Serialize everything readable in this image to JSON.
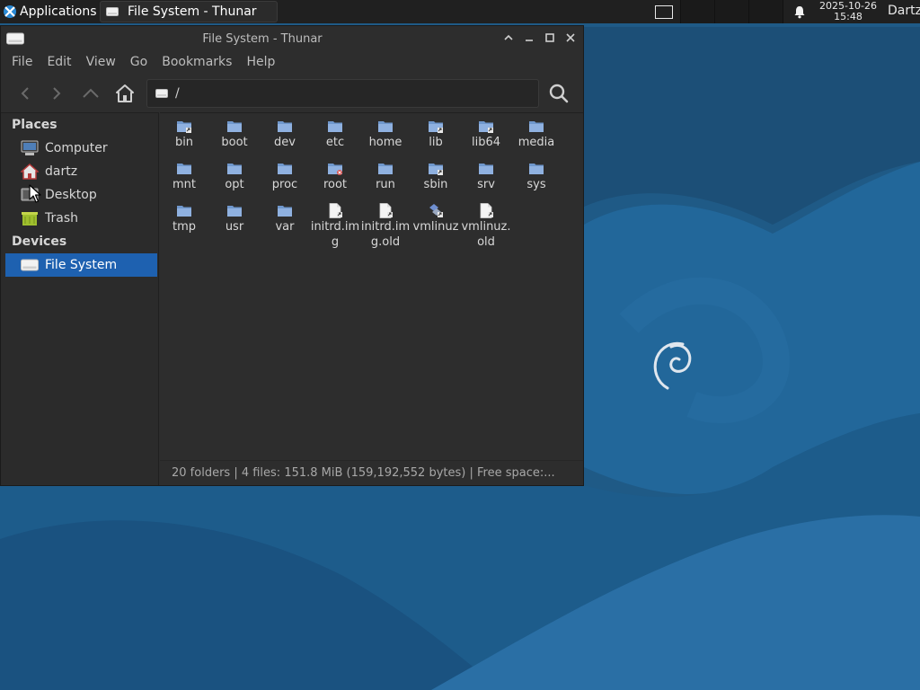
{
  "panel": {
    "applications_label": "Applications",
    "applications_icon": "xfce-mouse-icon",
    "task_label": "File System - Thunar",
    "task_icon": "drive-icon",
    "clock_date": "2025-10-26",
    "clock_time": "15:48",
    "user": "Dartz",
    "notification_icon": "bell-icon"
  },
  "window": {
    "title": "File System - Thunar",
    "controls": [
      "chevron-up-icon",
      "minimize-icon",
      "maximize-icon",
      "close-icon"
    ]
  },
  "menubar": [
    "File",
    "Edit",
    "View",
    "Go",
    "Bookmarks",
    "Help"
  ],
  "toolbar": {
    "buttons": [
      "back-icon",
      "forward-icon",
      "up-icon",
      "home-icon",
      "search-icon"
    ],
    "path": "/"
  },
  "sidebar": {
    "places_label": "Places",
    "places": [
      {
        "label": "Computer",
        "icon": "computer-icon"
      },
      {
        "label": "dartz",
        "icon": "home-folder-icon"
      },
      {
        "label": "Desktop",
        "icon": "desktop-icon"
      },
      {
        "label": "Trash",
        "icon": "trash-icon"
      }
    ],
    "devices_label": "Devices",
    "devices": [
      {
        "label": "File System",
        "icon": "drive-icon",
        "selected": true
      }
    ]
  },
  "files": [
    {
      "name": "bin",
      "type": "folder-link"
    },
    {
      "name": "boot",
      "type": "folder"
    },
    {
      "name": "dev",
      "type": "folder"
    },
    {
      "name": "etc",
      "type": "folder"
    },
    {
      "name": "home",
      "type": "folder"
    },
    {
      "name": "lib",
      "type": "folder-link"
    },
    {
      "name": "lib64",
      "type": "folder-link"
    },
    {
      "name": "media",
      "type": "folder"
    },
    {
      "name": "mnt",
      "type": "folder"
    },
    {
      "name": "opt",
      "type": "folder"
    },
    {
      "name": "proc",
      "type": "folder"
    },
    {
      "name": "root",
      "type": "folder-locked"
    },
    {
      "name": "run",
      "type": "folder"
    },
    {
      "name": "sbin",
      "type": "folder-link"
    },
    {
      "name": "srv",
      "type": "folder"
    },
    {
      "name": "sys",
      "type": "folder"
    },
    {
      "name": "tmp",
      "type": "folder"
    },
    {
      "name": "usr",
      "type": "folder"
    },
    {
      "name": "var",
      "type": "folder"
    },
    {
      "name": "initrd.img",
      "type": "file-link"
    },
    {
      "name": "initrd.img.old",
      "type": "file-link"
    },
    {
      "name": "vmlinuz",
      "type": "kernel-link"
    },
    {
      "name": "vmlinuz.old",
      "type": "file-link"
    }
  ],
  "statusbar": "20 folders  |  4 files: 151.8 MiB (159,192,552 bytes)  |  Free space:...",
  "colors": {
    "desktop": "#1f5a86",
    "panel": "#202020",
    "window": "#2d2d2d",
    "selection": "#1e61b0",
    "folder": "#7ea4d6"
  }
}
